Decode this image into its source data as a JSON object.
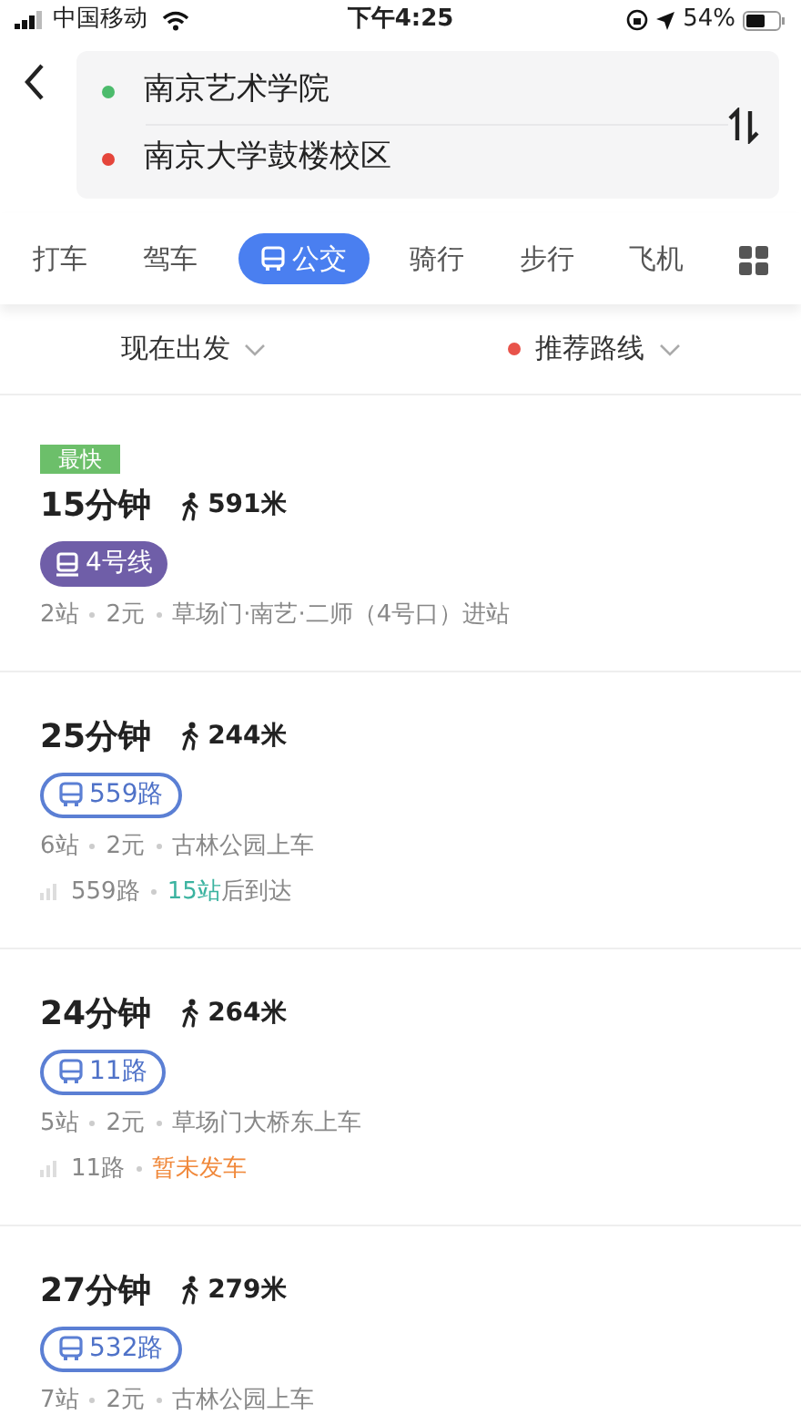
{
  "status_bar": {
    "carrier": "中国移动",
    "time": "下午4:25",
    "battery": "54%"
  },
  "route_input": {
    "origin": "南京艺术学院",
    "destination": "南京大学鼓楼校区"
  },
  "tabs": [
    {
      "kind": "text",
      "label": "打车",
      "selected": false
    },
    {
      "kind": "text",
      "label": "驾车",
      "selected": false
    },
    {
      "kind": "text",
      "label": "公交",
      "selected": true
    },
    {
      "kind": "text",
      "label": "骑行",
      "selected": false
    },
    {
      "kind": "text",
      "label": "步行",
      "selected": false
    },
    {
      "kind": "text",
      "label": "飞机",
      "selected": false
    },
    {
      "kind": "more",
      "selected": false
    }
  ],
  "filters": [
    {
      "label": "现在出发"
    },
    {
      "label": "推荐路线",
      "color": "#e8534a"
    }
  ],
  "routes": [
    {
      "badge": "最快",
      "duration": "15分钟",
      "walk": "591米",
      "line": {
        "kind": "metro",
        "name": "4号线"
      },
      "info": [
        "2站",
        "2元",
        "草场门·南艺·二师（4号口）进站"
      ]
    },
    {
      "duration": "25分钟",
      "walk": "244米",
      "line": {
        "kind": "bus",
        "name": "559路"
      },
      "info": [
        "6站",
        "2元",
        "古林公园上车"
      ],
      "realtime": {
        "line": "559路",
        "status": [
          {
            "text": "15站",
            "color": "#3bb3a0"
          },
          {
            "text": "后到达",
            "color": "#888888"
          }
        ]
      }
    },
    {
      "duration": "24分钟",
      "walk": "264米",
      "line": {
        "kind": "bus",
        "name": "11路"
      },
      "info": [
        "5站",
        "2元",
        "草场门大桥东上车"
      ],
      "realtime": {
        "line": "11路",
        "status": [
          {
            "text": "暂未发车",
            "color": "#f0883a"
          }
        ]
      }
    },
    {
      "duration": "27分钟",
      "walk": "279米",
      "line": {
        "kind": "bus",
        "name": "532路"
      },
      "info": [
        "7站",
        "2元",
        "古林公园上车"
      ]
    }
  ]
}
